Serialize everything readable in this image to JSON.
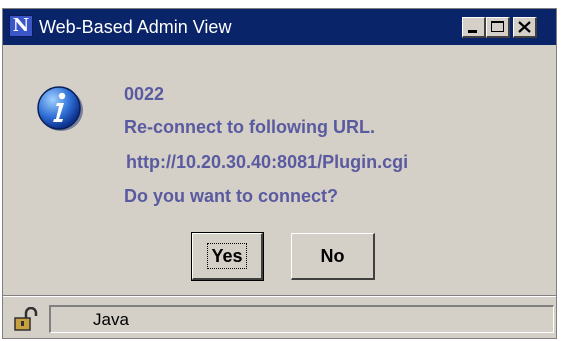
{
  "window": {
    "title": "Web-Based Admin View",
    "app_icon_letter": "N"
  },
  "message": {
    "code": "0022",
    "line1": "Re-connect to following URL.",
    "url": "http://10.20.30.40:8081/Plugin.cgi",
    "question": "Do you want to connect?"
  },
  "buttons": {
    "yes": "Yes",
    "no": "No"
  },
  "statusbar": {
    "text": "Java"
  },
  "colors": {
    "titlebar": "#0a246a",
    "message_text": "#5a5aa0",
    "dialog_bg": "#d4d0c8"
  },
  "icons": {
    "app": "netscape-n-icon",
    "message": "info-icon",
    "status": "unlocked-padlock-icon"
  }
}
